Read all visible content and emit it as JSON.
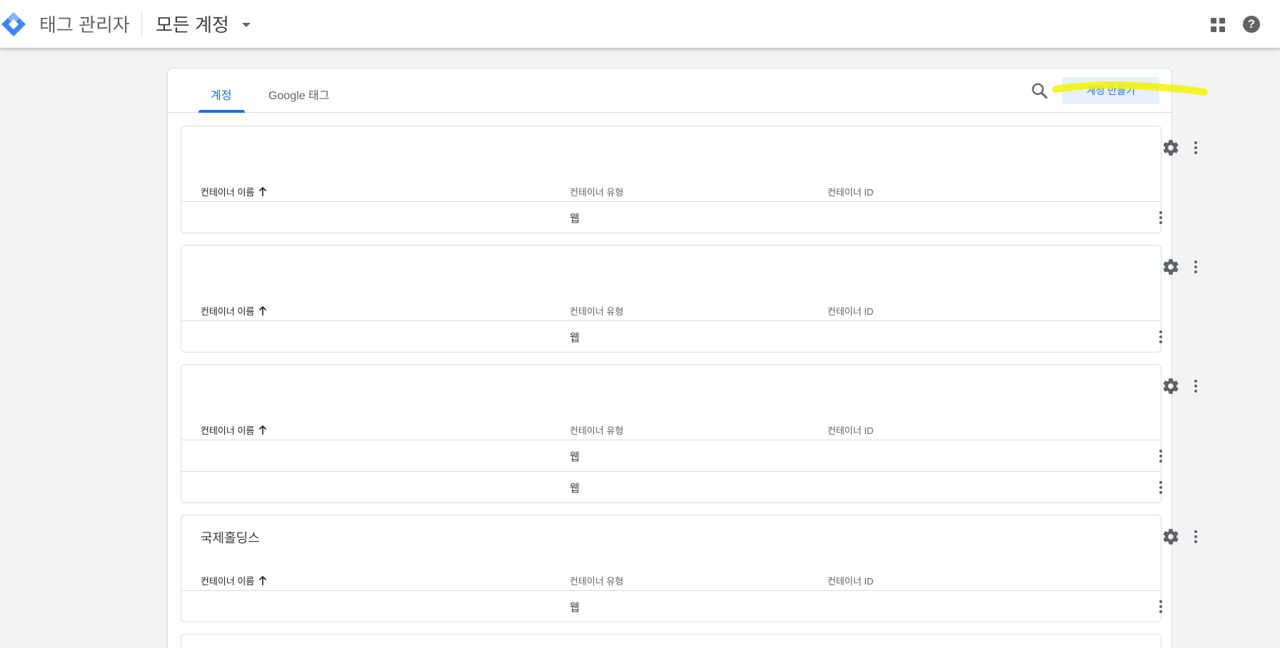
{
  "app": {
    "title": "태그 관리자",
    "account_selector": "모든 계정"
  },
  "tabs": [
    {
      "label": "계정",
      "active": true
    },
    {
      "label": "Google 태그",
      "active": false
    }
  ],
  "create_account_label": "계정 만들기",
  "colors": {
    "accent": "#1a73e8",
    "highlight": "#f2f200",
    "icon": "#5f6368"
  },
  "table_headers": {
    "name": "컨테이너 이름",
    "type": "컨테이너 유형",
    "id": "컨테이너 ID"
  },
  "accounts": [
    {
      "name": "",
      "rows": [
        {
          "type": "웹"
        }
      ]
    },
    {
      "name": "",
      "rows": [
        {
          "type": "웹"
        }
      ]
    },
    {
      "name": "",
      "rows": [
        {
          "type": "웹"
        },
        {
          "type": "웹"
        }
      ]
    },
    {
      "name": "국제홀딩스",
      "rows": [
        {
          "type": "웹"
        }
      ]
    }
  ]
}
